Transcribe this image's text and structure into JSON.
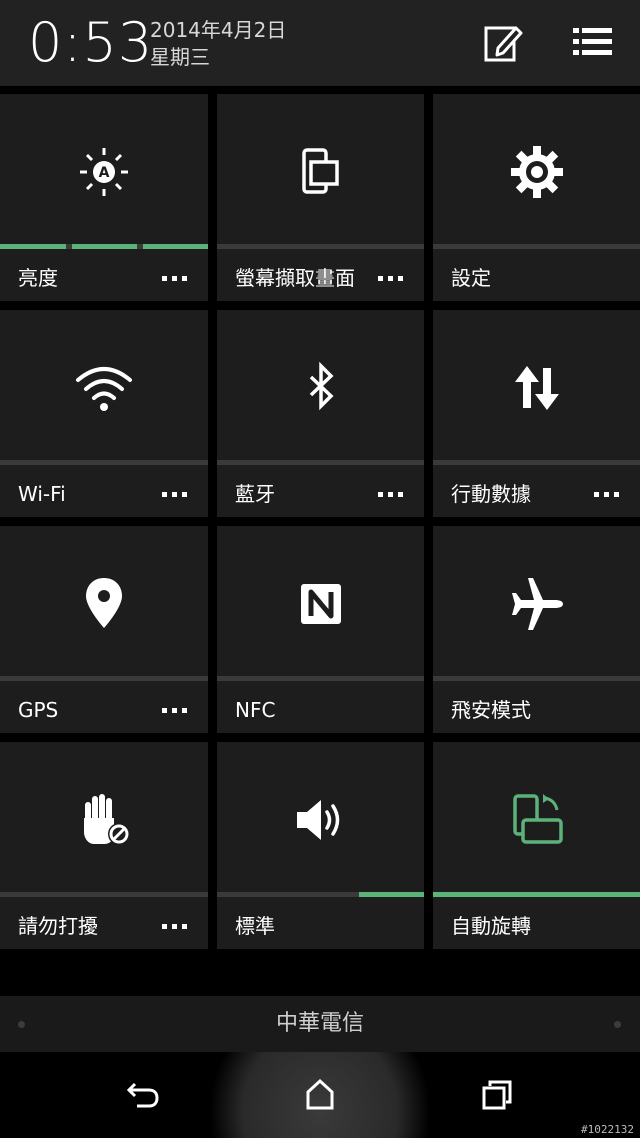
{
  "header": {
    "time": "0:53",
    "date": "2014年4月2日",
    "day": "星期三",
    "edit_icon": "edit-icon",
    "menu_icon": "list-menu-icon"
  },
  "tiles": [
    {
      "label": "亮度",
      "icon": "brightness-auto-icon",
      "has_more": true,
      "level": 1.0
    },
    {
      "label": "螢幕擷取畫面",
      "icon": "screenshot-icon",
      "has_more": true,
      "level": 0
    },
    {
      "label": "設定",
      "icon": "gear-icon",
      "has_more": false,
      "level": 0
    },
    {
      "label": "Wi-Fi",
      "icon": "wifi-icon",
      "has_more": true,
      "level": 0
    },
    {
      "label": "藍牙",
      "icon": "bluetooth-icon",
      "has_more": true,
      "level": 0
    },
    {
      "label": "行動數據",
      "icon": "mobile-data-icon",
      "has_more": true,
      "level": 0
    },
    {
      "label": "GPS",
      "icon": "location-pin-icon",
      "has_more": true,
      "level": 0
    },
    {
      "label": "NFC",
      "icon": "nfc-icon",
      "has_more": false,
      "level": 0
    },
    {
      "label": "飛安模式",
      "icon": "airplane-icon",
      "has_more": false,
      "level": 0
    },
    {
      "label": "請勿打擾",
      "icon": "do-not-disturb-hand-icon",
      "has_more": true,
      "level": 0
    },
    {
      "label": "標準",
      "icon": "volume-icon",
      "has_more": false,
      "level": 0.33
    },
    {
      "label": "自動旋轉",
      "icon": "auto-rotate-icon",
      "has_more": false,
      "level": 1.0
    }
  ],
  "carrier": "中華電信",
  "nav": {
    "back_icon": "back-icon",
    "home_icon": "home-icon",
    "recents_icon": "recent-apps-icon"
  },
  "watermark": "#1022132",
  "colors": {
    "accent": "#5cb37a",
    "tile_bg": "#1d1d1d",
    "header_bg": "#222222"
  }
}
